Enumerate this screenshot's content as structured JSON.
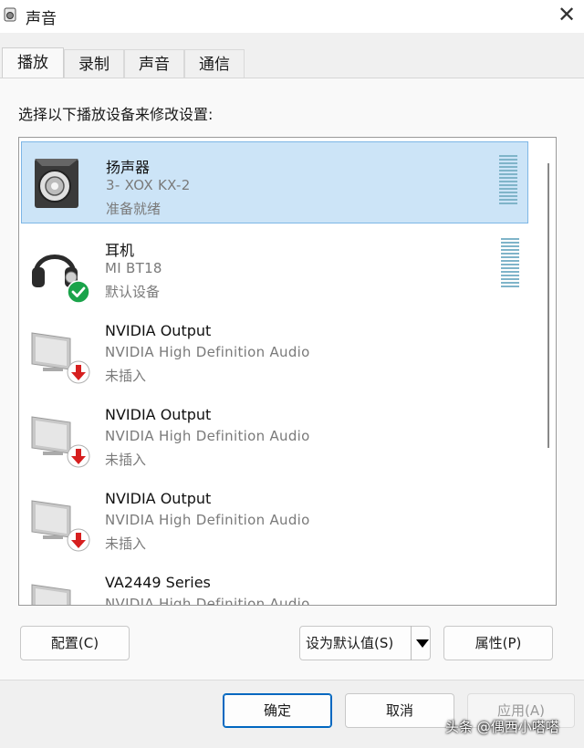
{
  "window": {
    "title": "声音",
    "close_glyph": "✕"
  },
  "tabs": [
    {
      "label": "播放",
      "active": true
    },
    {
      "label": "录制",
      "active": false
    },
    {
      "label": "声音",
      "active": false
    },
    {
      "label": "通信",
      "active": false
    }
  ],
  "instruction": "选择以下播放设备来修改设置:",
  "devices": [
    {
      "name": "扬声器",
      "description": "3- XOX KX-2",
      "status": "准备就绪",
      "icon": "speaker-icon",
      "selected": true,
      "badge": null
    },
    {
      "name": "耳机",
      "description": "MI BT18",
      "status": "默认设备",
      "icon": "headphones-icon",
      "selected": false,
      "badge": "default-check-icon"
    },
    {
      "name": "NVIDIA Output",
      "description": "NVIDIA High Definition Audio",
      "status": "未插入",
      "icon": "monitor-icon",
      "selected": false,
      "badge": "unplugged-arrow-icon"
    },
    {
      "name": "NVIDIA Output",
      "description": "NVIDIA High Definition Audio",
      "status": "未插入",
      "icon": "monitor-icon",
      "selected": false,
      "badge": "unplugged-arrow-icon"
    },
    {
      "name": "NVIDIA Output",
      "description": "NVIDIA High Definition Audio",
      "status": "未插入",
      "icon": "monitor-icon",
      "selected": false,
      "badge": "unplugged-arrow-icon"
    },
    {
      "name": "VA2449 Series",
      "description": "NVIDIA High Definition Audio",
      "status": "",
      "icon": "monitor-icon",
      "selected": false,
      "badge": null
    }
  ],
  "buttons": {
    "configure": "配置(C)",
    "set_default": "设为默认值(S)",
    "properties": "属性(P)",
    "ok": "确定",
    "cancel": "取消",
    "apply": "应用(A)"
  },
  "watermark": "头条 @偶西小嗒嗒",
  "colors": {
    "selection": "#cce4f7",
    "accent": "#0067c0",
    "check": "#1aa34a",
    "unplugged": "#d61f1f"
  }
}
